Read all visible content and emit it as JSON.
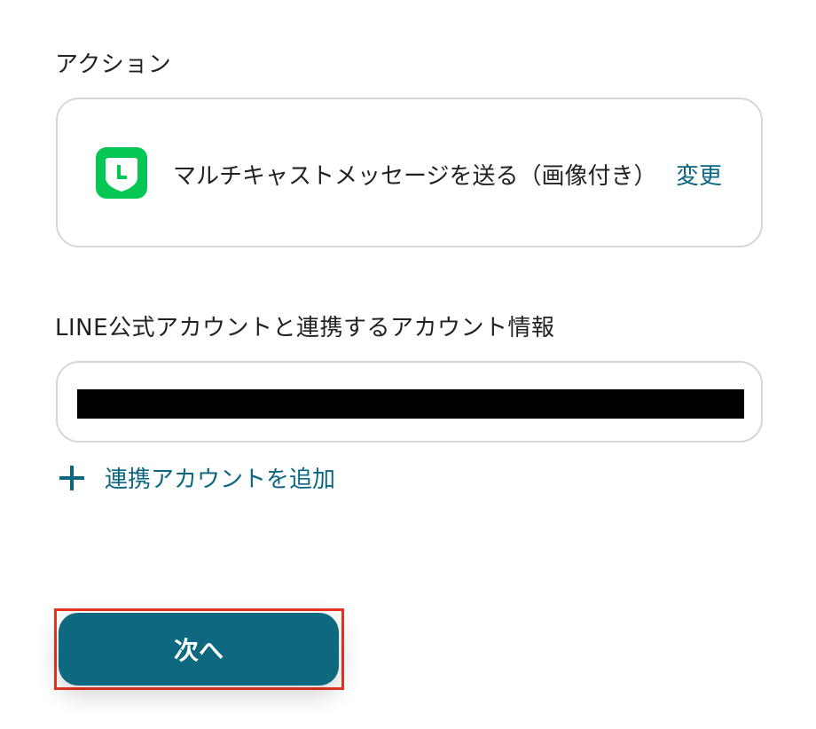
{
  "action_section": {
    "label": "アクション",
    "action_name": "マルチキャストメッセージを送る（画像付き）",
    "change_label": "変更",
    "icon": "line-app-icon",
    "icon_color": "#06c755"
  },
  "account_section": {
    "label": "LINE公式アカウントと連携するアカウント情報",
    "value": "",
    "add_account_label": "連携アカウントを追加",
    "add_icon": "plus-icon"
  },
  "footer": {
    "next_label": "次へ"
  },
  "colors": {
    "accent": "#0b6680",
    "button": "#0e6880",
    "highlight": "#ea3323",
    "border": "#d6d6d6"
  }
}
